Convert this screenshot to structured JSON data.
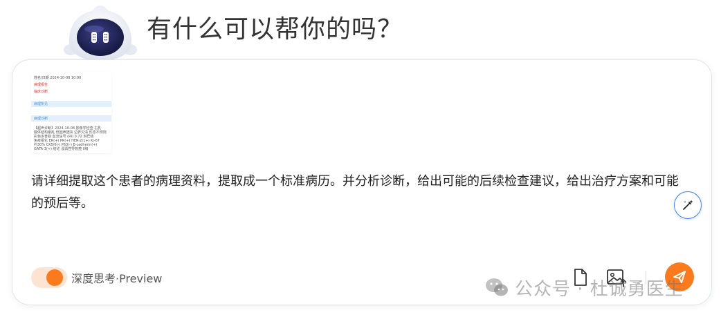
{
  "header": {
    "title": "有什么可以帮你的吗？"
  },
  "composer": {
    "attachment": {
      "lines": [
        "姓名/日期  2024-10-08 10:00",
        "病理报告",
        "临床诊断",
        "病理所见",
        "病理诊断",
        "【超声诊断】2024-10-08 影像学检查 右乳",
        "腺体结构紊乱 低回声团块 边界欠清 形态不规则",
        "彩色多普勒 血流信号 (RI) 0.72 淋巴结",
        "免疫组化 ER(+) PR(+) HER-2(1+) Ki-67",
        "约30% CK5/6(-) P63(-) E-cadherin(+)",
        "GATA-3(+) 结论 浸润性导管癌 II级",
        "..."
      ]
    },
    "prompt": "请详细提取这个患者的病理资料，提取成一个标准病历。并分析诊断，给出可能的后续检查建议，给出治疗方案和可能的预后等。",
    "toggle": {
      "label": "深度思考·Preview",
      "on": true
    }
  },
  "watermark": {
    "text": "公众号 · 杜诚勇医生"
  },
  "colors": {
    "accent": "#fb7a1d",
    "accent_soft": "#fde3d2",
    "magic_border": "#3b82f6",
    "text": "#222222"
  }
}
